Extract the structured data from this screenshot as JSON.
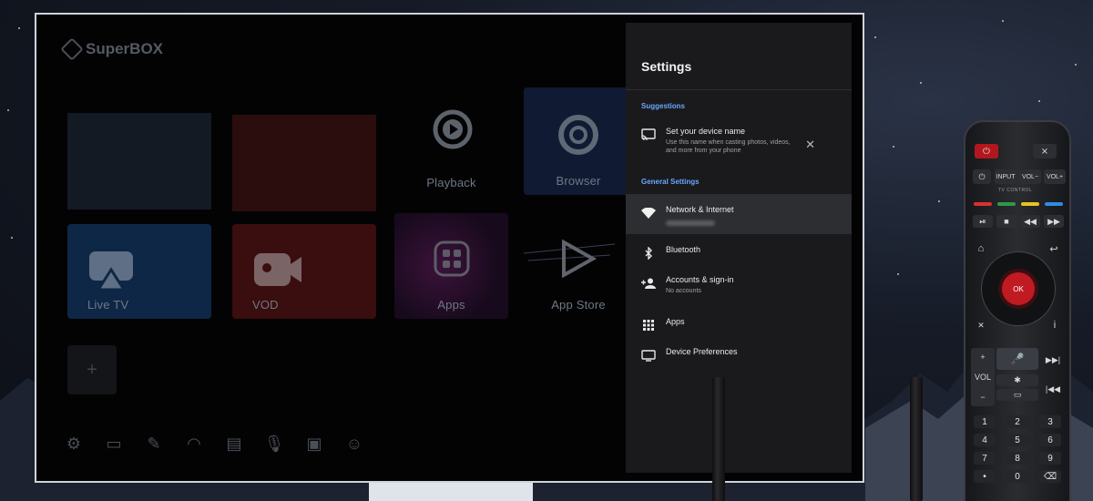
{
  "home": {
    "logo_text": "SuperBOX",
    "tiles": {
      "live_tv": "Live TV",
      "vod": "VOD",
      "playback": "Playback",
      "browser": "Browser",
      "apps": "Apps",
      "app_store": "App Store"
    },
    "add_label": "+",
    "bottom_icons": [
      "gear-icon",
      "folder-icon",
      "broom-icon",
      "speedometer-icon",
      "file-icon",
      "microphone-icon",
      "screen-cast-icon",
      "user-icon"
    ]
  },
  "settings": {
    "title": "Settings",
    "suggestions_label": "Suggestions",
    "suggestion": {
      "title": "Set your device name",
      "subtitle": "Use this name when casting photos, videos, and more from your phone",
      "dismiss": "✕"
    },
    "general_label": "General Settings",
    "items": [
      {
        "title": "Network & Internet",
        "subtitle": "",
        "icon": "wifi-icon"
      },
      {
        "title": "Bluetooth",
        "subtitle": "",
        "icon": "bluetooth-icon"
      },
      {
        "title": "Accounts & sign-in",
        "subtitle": "No accounts",
        "icon": "add-person-icon"
      },
      {
        "title": "Apps",
        "subtitle": "",
        "icon": "apps-grid-icon"
      },
      {
        "title": "Device Preferences",
        "subtitle": "",
        "icon": "tv-icon"
      }
    ]
  },
  "remote": {
    "input": "INPUT",
    "vol_minus": "VOL−",
    "vol_plus": "VOL+",
    "tv_control": "TV CONTROL",
    "ok": "OK",
    "vol": "VOL",
    "info": "i",
    "numbers": [
      "1",
      "2",
      "3",
      "4",
      "5",
      "6",
      "7",
      "8",
      "9",
      "•",
      "0",
      "⌫"
    ],
    "colors": [
      "#d93030",
      "#2f9a4a",
      "#e6c421",
      "#2d8de0"
    ]
  }
}
